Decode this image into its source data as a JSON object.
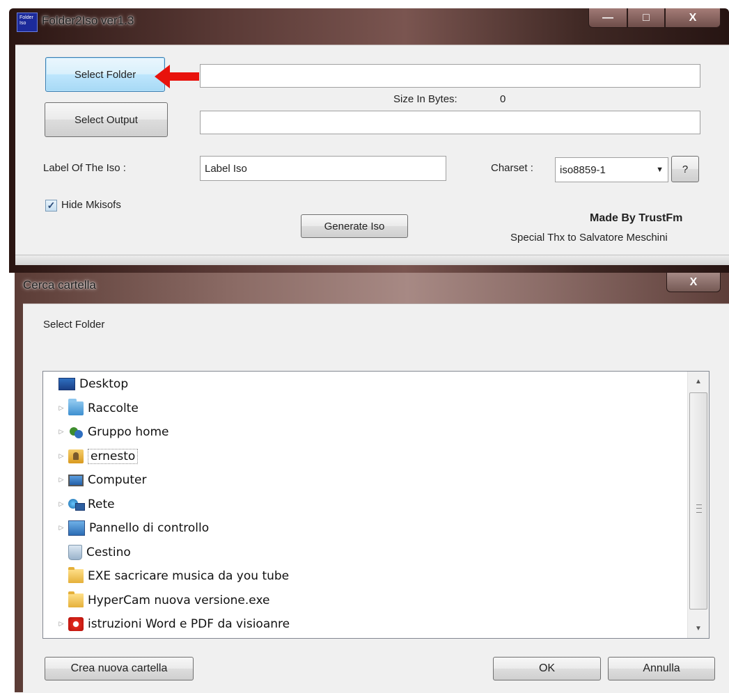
{
  "folder2iso": {
    "title": "Folder2Iso ver1.3",
    "app_icon_text": "Folder Iso",
    "select_folder_label": "Select Folder",
    "folder_path_value": "",
    "size_label": "Size In Bytes:",
    "size_value": "0",
    "select_output_label": "Select Output",
    "output_path_value": "",
    "label_of_iso_caption": "Label Of The Iso :",
    "label_of_iso_value": "Label Iso",
    "charset_caption": "Charset :",
    "charset_value": "iso8859-1",
    "help_label": "?",
    "hide_mkisofs_label": "Hide Mkisofs",
    "hide_mkisofs_checked": true,
    "generate_label": "Generate Iso",
    "credit_line1": "Made By TrustFm",
    "credit_line2": "Special Thx to Salvatore Meschini",
    "caption_buttons": {
      "minimize": "—",
      "maximize": "□",
      "close": "X"
    }
  },
  "browse_dialog": {
    "title": "Cerca cartella",
    "instruction": "Select Folder",
    "tree_items": [
      {
        "label": "Desktop",
        "icon": "desktop-icon",
        "expandable": false
      },
      {
        "label": "Raccolte",
        "icon": "libraries-icon",
        "expandable": true
      },
      {
        "label": "Gruppo home",
        "icon": "homegroup-icon",
        "expandable": true
      },
      {
        "label": "ernesto",
        "icon": "user-folder-icon",
        "expandable": true,
        "selected": true
      },
      {
        "label": "Computer",
        "icon": "computer-icon",
        "expandable": true
      },
      {
        "label": "Rete",
        "icon": "network-icon",
        "expandable": true
      },
      {
        "label": "Pannello di controllo",
        "icon": "control-panel-icon",
        "expandable": true
      },
      {
        "label": "Cestino",
        "icon": "recycle-bin-icon",
        "expandable": false
      },
      {
        "label": "EXE sacricare musica da you tube",
        "icon": "folder-icon",
        "expandable": false
      },
      {
        "label": "HyperCam nuova versione.exe",
        "icon": "folder-icon",
        "expandable": false
      },
      {
        "label": "istruzioni Word e PDF da visioanre",
        "icon": "pdf-icon",
        "expandable": true
      }
    ],
    "new_folder_label": "Crea nuova cartella",
    "ok_label": "OK",
    "cancel_label": "Annulla",
    "close_label": "X"
  },
  "colors": {
    "annotation_arrow": "#e8120c",
    "focus_button_border": "#3c7fb1"
  }
}
